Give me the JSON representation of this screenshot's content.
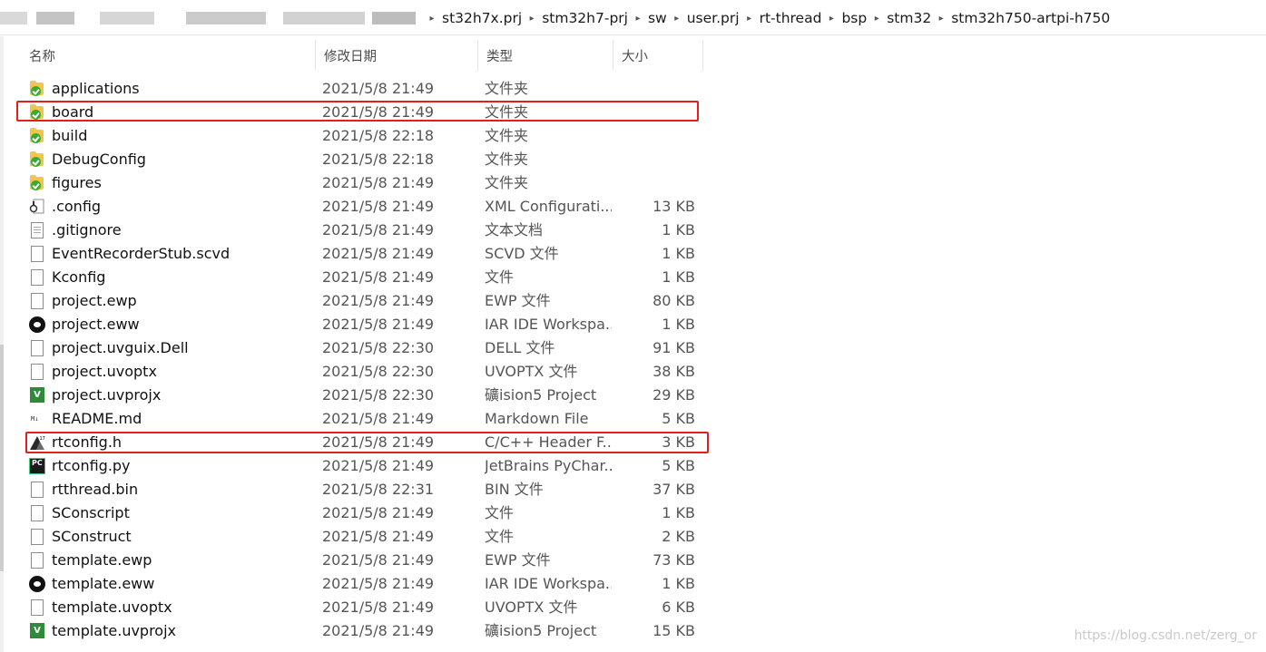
{
  "breadcrumb": [
    "st32h7x.prj",
    "stm32h7-prj",
    "sw",
    "user.prj",
    "rt-thread",
    "bsp",
    "stm32",
    "stm32h750-artpi-h750"
  ],
  "columns": {
    "name": "名称",
    "date": "修改日期",
    "type": "类型",
    "size": "大小"
  },
  "files": [
    {
      "name": "applications",
      "date": "2021/5/8 21:49",
      "type": "文件夹",
      "size": "",
      "icon": "folder-synced-icon"
    },
    {
      "name": "board",
      "date": "2021/5/8 21:49",
      "type": "文件夹",
      "size": "",
      "icon": "folder-synced-icon"
    },
    {
      "name": "build",
      "date": "2021/5/8 22:18",
      "type": "文件夹",
      "size": "",
      "icon": "folder-synced-icon"
    },
    {
      "name": "DebugConfig",
      "date": "2021/5/8 22:18",
      "type": "文件夹",
      "size": "",
      "icon": "folder-synced-icon"
    },
    {
      "name": "figures",
      "date": "2021/5/8 21:49",
      "type": "文件夹",
      "size": "",
      "icon": "folder-synced-icon"
    },
    {
      "name": ".config",
      "date": "2021/5/8 21:49",
      "type": "XML Configurati...",
      "size": "13 KB",
      "icon": "xml-config-icon"
    },
    {
      "name": ".gitignore",
      "date": "2021/5/8 21:49",
      "type": "文本文档",
      "size": "1 KB",
      "icon": "text-file-icon"
    },
    {
      "name": "EventRecorderStub.scvd",
      "date": "2021/5/8 21:49",
      "type": "SCVD 文件",
      "size": "1 KB",
      "icon": "blank-file-icon"
    },
    {
      "name": "Kconfig",
      "date": "2021/5/8 21:49",
      "type": "文件",
      "size": "1 KB",
      "icon": "blank-file-icon"
    },
    {
      "name": "project.ewp",
      "date": "2021/5/8 21:49",
      "type": "EWP 文件",
      "size": "80 KB",
      "icon": "blank-file-icon"
    },
    {
      "name": "project.eww",
      "date": "2021/5/8 21:49",
      "type": "IAR IDE Workspa...",
      "size": "1 KB",
      "icon": "iar-workspace-icon"
    },
    {
      "name": "project.uvguix.Dell",
      "date": "2021/5/8 22:30",
      "type": "DELL 文件",
      "size": "91 KB",
      "icon": "blank-file-icon"
    },
    {
      "name": "project.uvoptx",
      "date": "2021/5/8 22:30",
      "type": "UVOPTX 文件",
      "size": "38 KB",
      "icon": "blank-file-icon"
    },
    {
      "name": "project.uvprojx",
      "date": "2021/5/8 22:30",
      "type": "礦ision5 Project",
      "size": "29 KB",
      "icon": "uvision-project-icon"
    },
    {
      "name": "README.md",
      "date": "2021/5/8 21:49",
      "type": "Markdown File",
      "size": "5 KB",
      "icon": "markdown-file-icon"
    },
    {
      "name": "rtconfig.h",
      "date": "2021/5/8 21:49",
      "type": "C/C++ Header F...",
      "size": "3 KB",
      "icon": "c-header-file-icon"
    },
    {
      "name": "rtconfig.py",
      "date": "2021/5/8 21:49",
      "type": "JetBrains PyChar...",
      "size": "5 KB",
      "icon": "pycharm-file-icon"
    },
    {
      "name": "rtthread.bin",
      "date": "2021/5/8 22:31",
      "type": "BIN 文件",
      "size": "37 KB",
      "icon": "blank-file-icon"
    },
    {
      "name": "SConscript",
      "date": "2021/5/8 21:49",
      "type": "文件",
      "size": "1 KB",
      "icon": "blank-file-icon"
    },
    {
      "name": "SConstruct",
      "date": "2021/5/8 21:49",
      "type": "文件",
      "size": "2 KB",
      "icon": "blank-file-icon"
    },
    {
      "name": "template.ewp",
      "date": "2021/5/8 21:49",
      "type": "EWP 文件",
      "size": "73 KB",
      "icon": "blank-file-icon"
    },
    {
      "name": "template.eww",
      "date": "2021/5/8 21:49",
      "type": "IAR IDE Workspa...",
      "size": "1 KB",
      "icon": "iar-workspace-icon"
    },
    {
      "name": "template.uvoptx",
      "date": "2021/5/8 21:49",
      "type": "UVOPTX 文件",
      "size": "6 KB",
      "icon": "blank-file-icon"
    },
    {
      "name": "template.uvprojx",
      "date": "2021/5/8 21:49",
      "type": "礦ision5 Project",
      "size": "15 KB",
      "icon": "uvision-project-icon"
    }
  ],
  "highlight_color": "#e0201e",
  "watermark": "https://blog.csdn.net/zerg_or"
}
